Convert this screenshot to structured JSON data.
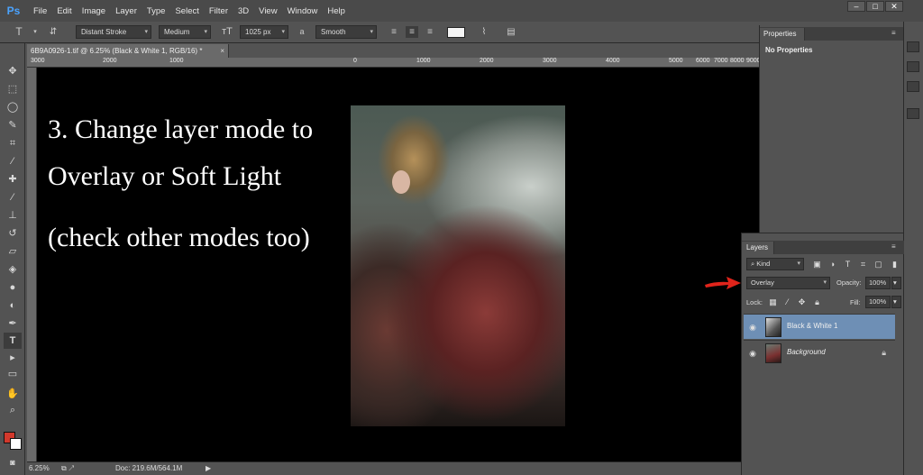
{
  "app": {
    "logo": "Ps"
  },
  "menu": [
    "File",
    "Edit",
    "Image",
    "Layer",
    "Type",
    "Select",
    "Filter",
    "3D",
    "View",
    "Window",
    "Help"
  ],
  "window_controls": [
    "–",
    "□",
    "✕"
  ],
  "options_bar": {
    "tool_icon": "T",
    "font_family": "Distant Stroke",
    "font_style": "Medium",
    "font_size": "1025 px",
    "aa_label": "a",
    "anti_alias": "Smooth"
  },
  "document_tab": {
    "title": "6B9A0926-1.tif @ 6.25% (Black & White 1, RGB/16) *",
    "close": "×"
  },
  "ruler_top": [
    "3000",
    "2000",
    "1000",
    "0",
    "1000",
    "2000",
    "3000",
    "4000",
    "5000",
    "6000",
    "7000",
    "8000",
    "9000"
  ],
  "canvas_text": {
    "line1": "3. Change layer mode to",
    "line2": "Overlay or Soft Light",
    "line3": "(check other modes too)"
  },
  "status_bar": {
    "zoom": "6.25%",
    "doc": "Doc: 219.6M/564.1M",
    "arrow": "▶"
  },
  "properties_panel": {
    "tab": "Properties",
    "message": "No Properties"
  },
  "layers_panel": {
    "tab": "Layers",
    "filter_kind": "Kind",
    "blend_mode": "Overlay",
    "opacity_label": "Opacity:",
    "opacity_value": "100%",
    "lock_label": "Lock:",
    "fill_label": "Fill:",
    "fill_value": "100%",
    "layers": [
      {
        "name": "Black & White 1",
        "selected": true,
        "locked": false
      },
      {
        "name": "Background",
        "selected": false,
        "locked": true
      }
    ]
  },
  "colors": {
    "foreground": "#d2392c",
    "background": "#ffffff",
    "selected_layer": "#6e8fb5",
    "annotation_arrow": "#e0241b"
  }
}
